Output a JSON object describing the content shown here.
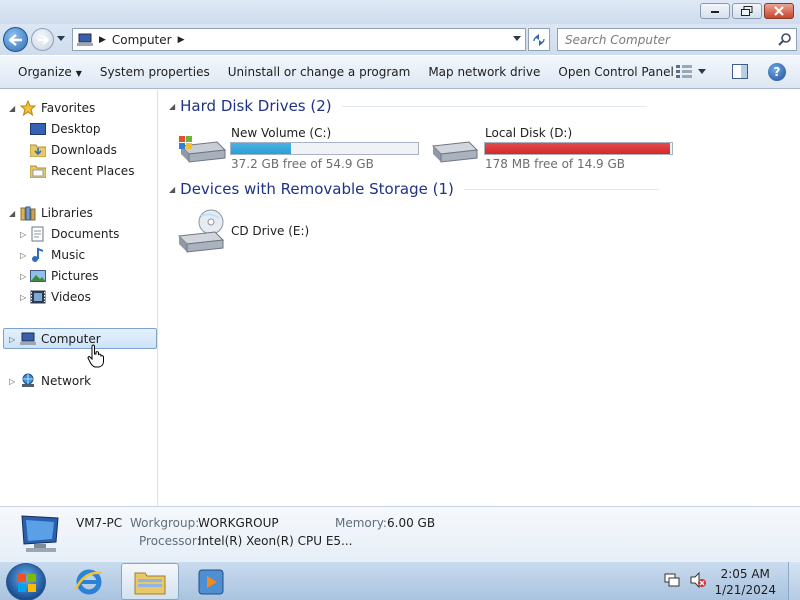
{
  "address": {
    "crumb": "Computer",
    "search_placeholder": "Search Computer"
  },
  "toolbar": {
    "organize": "Organize",
    "system_properties": "System properties",
    "uninstall": "Uninstall or change a program",
    "map_network_drive": "Map network drive",
    "open_control_panel": "Open Control Panel",
    "help": "?"
  },
  "nav": {
    "favorites": {
      "label": "Favorites",
      "items": [
        "Desktop",
        "Downloads",
        "Recent Places"
      ]
    },
    "libraries": {
      "label": "Libraries",
      "items": [
        "Documents",
        "Music",
        "Pictures",
        "Videos"
      ]
    },
    "computer": "Computer",
    "network": "Network"
  },
  "content": {
    "hard_disk_header": "Hard Disk Drives (2)",
    "removable_header": "Devices with Removable Storage (1)",
    "drives": [
      {
        "name": "New Volume (C:)",
        "free_text": "37.2 GB free of 54.9 GB",
        "used_fraction": 0.32,
        "bar_color": "#26a0da"
      },
      {
        "name": "Local Disk (D:)",
        "free_text": "178 MB free of 14.9 GB",
        "used_fraction": 0.99,
        "bar_color": "#da2626"
      }
    ],
    "cd_drive": "CD Drive (E:)"
  },
  "details": {
    "pc_name": "VM7-PC",
    "workgroup_label": "Workgroup:",
    "workgroup_value": "WORKGROUP",
    "memory_label": "Memory:",
    "memory_value": "6.00 GB",
    "processor_label": "Processor:",
    "processor_value": "Intel(R) Xeon(R) CPU E5..."
  },
  "taskbar": {
    "time": "2:05 AM",
    "date": "1/21/2024"
  },
  "colors": {
    "accent": "#1e3287",
    "selection": "#cde3f8",
    "taskbar": "#b6cde6"
  }
}
